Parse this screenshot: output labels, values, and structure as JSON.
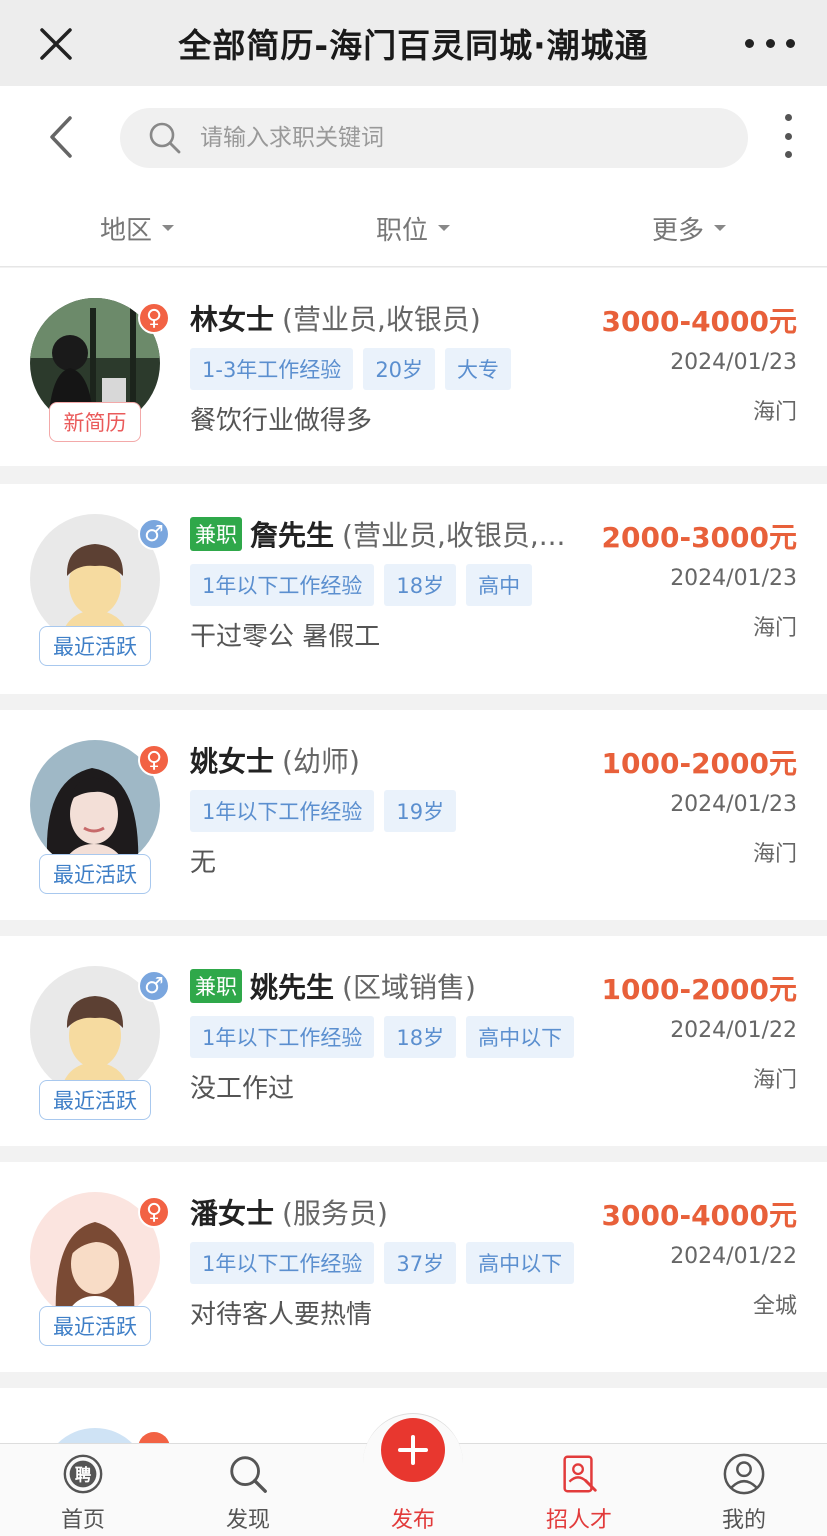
{
  "window": {
    "title": "全部简历-海门百灵同城·潮城通"
  },
  "search": {
    "placeholder": "请输入求职关键词"
  },
  "filters": [
    {
      "label": "地区"
    },
    {
      "label": "职位"
    },
    {
      "label": "更多"
    }
  ],
  "resumes": [
    {
      "name": "林女士",
      "positions": "(营业员,收银员)",
      "part_time": "",
      "gender": "female",
      "tags": [
        "1-3年工作经验",
        "20岁",
        "大专"
      ],
      "description": "餐饮行业做得多",
      "salary": "3000-4000元",
      "date": "2024/01/23",
      "location": "海门",
      "status": "新简历"
    },
    {
      "name": "詹先生",
      "positions": "(营业员,收银员,...",
      "part_time": "兼职",
      "gender": "male",
      "tags": [
        "1年以下工作经验",
        "18岁",
        "高中"
      ],
      "description": "干过零公 暑假工",
      "salary": "2000-3000元",
      "date": "2024/01/23",
      "location": "海门",
      "status": "最近活跃"
    },
    {
      "name": "姚女士",
      "positions": "(幼师)",
      "part_time": "",
      "gender": "female",
      "tags": [
        "1年以下工作经验",
        "19岁"
      ],
      "description": "无",
      "salary": "1000-2000元",
      "date": "2024/01/23",
      "location": "海门",
      "status": "最近活跃"
    },
    {
      "name": "姚先生",
      "positions": "(区域销售)",
      "part_time": "兼职",
      "gender": "male",
      "tags": [
        "1年以下工作经验",
        "18岁",
        "高中以下"
      ],
      "description": "没工作过",
      "salary": "1000-2000元",
      "date": "2024/01/22",
      "location": "海门",
      "status": "最近活跃"
    },
    {
      "name": "潘女士",
      "positions": "(服务员)",
      "part_time": "",
      "gender": "female",
      "tags": [
        "1年以下工作经验",
        "37岁",
        "高中以下"
      ],
      "description": "对待客人要热情",
      "salary": "3000-4000元",
      "date": "2024/01/22",
      "location": "全城",
      "status": "最近活跃"
    }
  ],
  "gender_symbols": {
    "female": "♀",
    "male": "♂"
  },
  "bottom_nav": {
    "items": [
      {
        "label": "首页",
        "icon": "recruit-icon"
      },
      {
        "label": "发现",
        "icon": "search-icon"
      },
      {
        "label": "发布",
        "icon": "plus-icon"
      },
      {
        "label": "招人才",
        "icon": "resume-icon"
      },
      {
        "label": "我的",
        "icon": "user-icon"
      }
    ],
    "active": "招人才",
    "recruit_glyph": "聘"
  },
  "colors": {
    "accent_red": "#e8372f",
    "salary": "#e8603a",
    "tag_blue": "#5b8fcf",
    "part_time_green": "#2fa84a"
  }
}
